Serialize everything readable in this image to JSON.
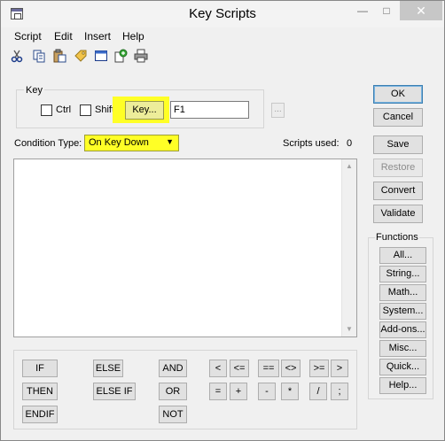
{
  "window": {
    "title": "Key Scripts"
  },
  "menu": [
    "Script",
    "Edit",
    "Insert",
    "Help"
  ],
  "toolbar": {
    "icons": [
      "cut-icon",
      "copy-icon",
      "paste-icon",
      "tag-icon",
      "window-icon",
      "add-page-icon",
      "print-icon"
    ]
  },
  "key_group": {
    "label": "Key",
    "ctrl_label": "Ctrl",
    "shift_label": "Shift",
    "key_button": "Key...",
    "key_value": "F1",
    "browse": "..."
  },
  "condition": {
    "label": "Condition Type:",
    "value": "On Key Down"
  },
  "scripts_used": {
    "label": "Scripts used:",
    "value": "0"
  },
  "buttons": {
    "ok": "OK",
    "cancel": "Cancel",
    "save": "Save",
    "restore": "Restore",
    "convert": "Convert",
    "validate": "Validate"
  },
  "functions": {
    "label": "Functions",
    "items": [
      "All...",
      "String...",
      "Math...",
      "System...",
      "Add-ons...",
      "Misc...",
      "Quick...",
      "Help..."
    ]
  },
  "keywords": {
    "if": "IF",
    "then": "THEN",
    "endif": "ENDIF",
    "else": "ELSE",
    "else_if": "ELSE IF",
    "and": "AND",
    "or": "OR",
    "not": "NOT"
  },
  "operators": {
    "lt": "<",
    "le": "<=",
    "eq": "==",
    "ne": "<>",
    "ge": ">=",
    "gt": ">",
    "assign": "=",
    "plus": "+",
    "minus": "-",
    "mult": "*",
    "div": "/",
    "semi": ";"
  },
  "colors": {
    "highlight": "#ffff26"
  }
}
